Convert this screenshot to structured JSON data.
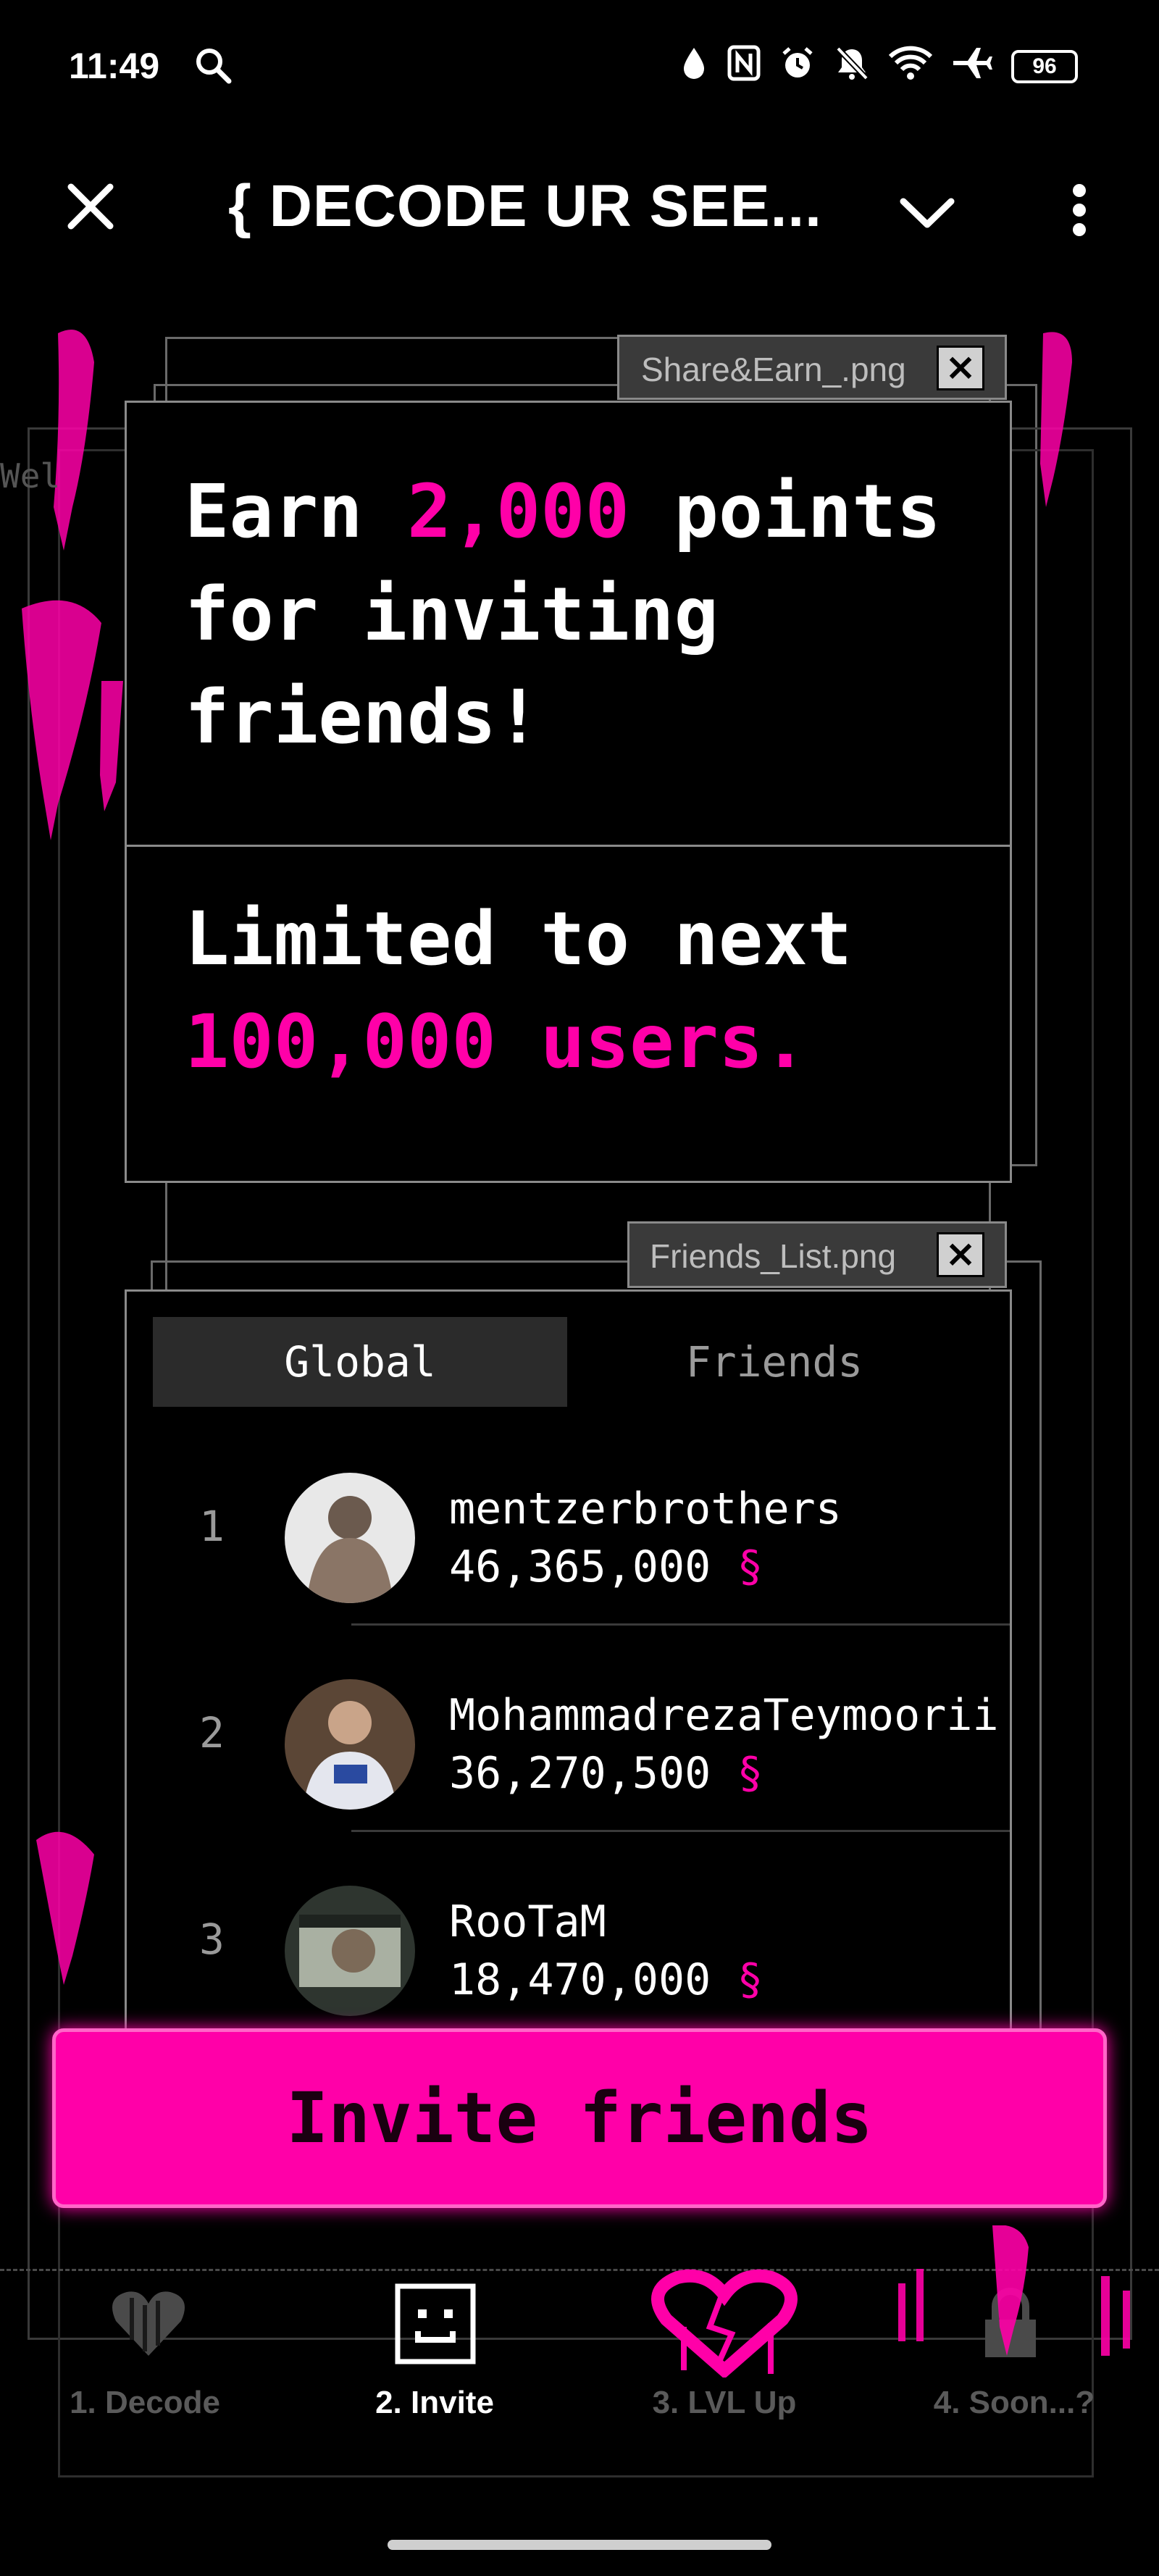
{
  "status_bar": {
    "time": "11:49",
    "battery": "96",
    "icons": [
      "search-icon",
      "drop-icon",
      "nfc-icon",
      "alarm-icon",
      "mute-icon",
      "wifi-icon",
      "airplane-icon",
      "battery-icon"
    ]
  },
  "header": {
    "title": "{ DECODE UR SEE..."
  },
  "share_panel": {
    "window_label": "Share&Earn_.png",
    "earn_prefix": "Earn ",
    "earn_amount": "2,000",
    "earn_suffix": " points for inviting friends!",
    "limit_prefix": "Limited to next",
    "limit_highlight": "100,000 users."
  },
  "friends_panel": {
    "window_label": "Friends_List.png",
    "tabs": [
      "Global",
      "Friends"
    ],
    "entries": [
      {
        "rank": "1",
        "name": "mentzerbrothers",
        "score": "46,365,000",
        "currency": "§"
      },
      {
        "rank": "2",
        "name": "MohammadrezaTeymoorii",
        "score": "36,270,500",
        "currency": "§"
      },
      {
        "rank": "3",
        "name": "RooTaM",
        "score": "18,470,000",
        "currency": "§"
      }
    ]
  },
  "invite_button": {
    "label": "Invite friends"
  },
  "nav": [
    {
      "label": "1. Decode",
      "icon": "heart-icon",
      "active": false
    },
    {
      "label": "2. Invite",
      "icon": "smiley-icon",
      "active": true
    },
    {
      "label": "3. LVL Up",
      "icon": "broken-heart-icon",
      "active": false
    },
    {
      "label": "4. Soon...?",
      "icon": "lock-icon",
      "active": false
    }
  ],
  "colors": {
    "accent": "#ff00a8",
    "background": "#000000",
    "panel_border": "#8a8a8a"
  }
}
